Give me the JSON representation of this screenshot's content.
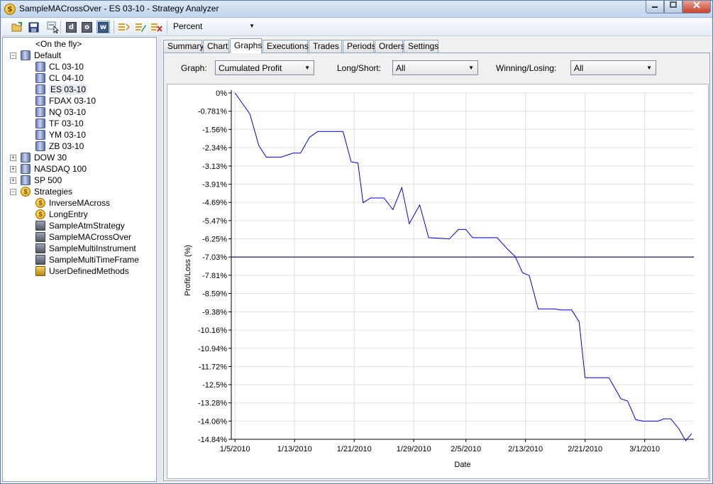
{
  "window": {
    "title": "SampleMACrossOver - ES 03-10 - Strategy Analyzer",
    "icon_glyph": "$"
  },
  "toolbar": {
    "icons": [
      "open-folder-icon",
      "save-icon",
      "backtest-icon",
      "daily-icon",
      "optimize-icon",
      "walk-forward-icon",
      "instrument-list-icon",
      "edit-list-icon",
      "remove-list-icon"
    ],
    "button_letters": {
      "d": "d",
      "o": "o",
      "w": "w"
    },
    "units_value": "Percent"
  },
  "tree": {
    "on_the_fly": "<On the fly>",
    "default_label": "Default",
    "default_items": [
      "CL 03-10",
      "CL 04-10",
      "ES 03-10",
      "FDAX 03-10",
      "NQ 03-10",
      "TF 03-10",
      "YM 03-10",
      "ZB 03-10"
    ],
    "selected_item": "ES 03-10",
    "groups": [
      "DOW 30",
      "NASDAQ 100",
      "SP 500"
    ],
    "strategies_label": "Strategies",
    "strategies": [
      {
        "label": "InverseMAcross",
        "icon": "coin-icon"
      },
      {
        "label": "LongEntry",
        "icon": "coin-icon"
      },
      {
        "label": "SampleAtmStrategy",
        "icon": "strategy-icon"
      },
      {
        "label": "SampleMACrossOver",
        "icon": "strategy-icon"
      },
      {
        "label": "SampleMultiInstrument",
        "icon": "strategy-icon"
      },
      {
        "label": "SampleMultiTimeFrame",
        "icon": "strategy-icon"
      },
      {
        "label": "UserDefinedMethods",
        "icon": "box-icon"
      }
    ],
    "expander_plus": "+",
    "expander_minus": "−"
  },
  "tabs": [
    "Summary",
    "Chart",
    "Graphs",
    "Executions",
    "Trades",
    "Periods",
    "Orders",
    "Settings"
  ],
  "active_tab": "Graphs",
  "filters": {
    "graph_label": "Graph:",
    "graph_value": "Cumulated Profit",
    "longshort_label": "Long/Short:",
    "longshort_value": "All",
    "winning_label": "Winning/Losing:",
    "winning_value": "All"
  },
  "colors": {
    "series": "#0000e0",
    "reference_line": "#00006e",
    "grid": "#e0e0e0"
  },
  "chart_data": {
    "type": "line",
    "xlabel": "Date",
    "ylabel": "Profit/Loss (%)",
    "x_ticks": [
      "1/5/2010",
      "1/13/2010",
      "1/21/2010",
      "1/29/2010",
      "2/5/2010",
      "2/13/2010",
      "2/21/2010",
      "3/1/2010"
    ],
    "y_ticks": [
      "0%",
      "-0.781%",
      "-1.56%",
      "-2.34%",
      "-3.13%",
      "-3.91%",
      "-4.69%",
      "-5.47%",
      "-6.25%",
      "-7.03%",
      "-7.81%",
      "-8.59%",
      "-9.38%",
      "-10.16%",
      "-10.94%",
      "-11.72%",
      "-12.5%",
      "-13.28%",
      "-14.06%",
      "-14.84%"
    ],
    "y_tick_values": [
      0,
      -0.781,
      -1.56,
      -2.34,
      -3.13,
      -3.91,
      -4.69,
      -5.47,
      -6.25,
      -7.03,
      -7.81,
      -8.59,
      -9.38,
      -10.16,
      -10.94,
      -11.72,
      -12.5,
      -13.28,
      -14.06,
      -14.84
    ],
    "ylim": [
      -14.84,
      0
    ],
    "reference_line_y": -7.03,
    "grid": true,
    "series": [
      {
        "values": [
          [
            0.0,
            0.0
          ],
          [
            2.0,
            -0.9
          ],
          [
            3.2,
            -2.25
          ],
          [
            4.2,
            -2.75
          ],
          [
            6.2,
            -2.75
          ],
          [
            7.8,
            -2.58
          ],
          [
            8.8,
            -2.58
          ],
          [
            10.0,
            -1.9
          ],
          [
            11.1,
            -1.65
          ],
          [
            14.5,
            -1.65
          ],
          [
            15.6,
            -2.95
          ],
          [
            16.5,
            -3.0
          ],
          [
            17.2,
            -4.7
          ],
          [
            18.2,
            -4.5
          ],
          [
            20.0,
            -4.5
          ],
          [
            21.2,
            -5.0
          ],
          [
            22.4,
            -4.05
          ],
          [
            23.4,
            -5.6
          ],
          [
            24.8,
            -4.8
          ],
          [
            26.0,
            -6.2
          ],
          [
            28.8,
            -6.25
          ],
          [
            30.0,
            -5.85
          ],
          [
            31.0,
            -5.85
          ],
          [
            31.9,
            -6.2
          ],
          [
            35.2,
            -6.2
          ],
          [
            36.6,
            -6.7
          ],
          [
            37.6,
            -7.0
          ],
          [
            38.6,
            -7.7
          ],
          [
            39.5,
            -7.82
          ],
          [
            40.7,
            -9.25
          ],
          [
            42.8,
            -9.25
          ],
          [
            43.8,
            -9.3
          ],
          [
            45.2,
            -9.3
          ],
          [
            46.2,
            -9.8
          ],
          [
            47.0,
            -12.2
          ],
          [
            50.2,
            -12.2
          ],
          [
            51.8,
            -13.1
          ],
          [
            52.7,
            -13.2
          ],
          [
            53.8,
            -14.0
          ],
          [
            54.8,
            -14.06
          ],
          [
            56.8,
            -14.06
          ],
          [
            57.6,
            -13.96
          ],
          [
            58.5,
            -13.96
          ],
          [
            59.6,
            -14.4
          ],
          [
            60.5,
            -14.9
          ],
          [
            61.3,
            -14.6
          ]
        ]
      }
    ],
    "x_tick_days": [
      0,
      8,
      16,
      24,
      31,
      39,
      47,
      55
    ]
  }
}
